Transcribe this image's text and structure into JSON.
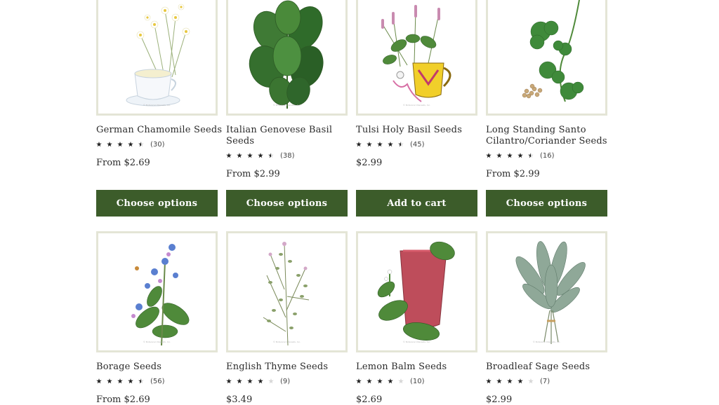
{
  "products": [
    {
      "name": "German Chamomile Seeds",
      "rating_value": 4.5,
      "review_count": "(30)",
      "price": "From $2.69",
      "button": "Choose options",
      "image_icon": "chamomile-illustration",
      "watermark": "© Botanical Interests, Inc."
    },
    {
      "name": "Italian Genovese Basil Seeds",
      "rating_value": 4.5,
      "review_count": "(38)",
      "price": "From $2.99",
      "button": "Choose options",
      "image_icon": "basil-illustration",
      "watermark": "© Botanical Interests, Inc."
    },
    {
      "name": "Tulsi Holy Basil Seeds",
      "rating_value": 4.5,
      "review_count": "(45)",
      "price": "$2.99",
      "button": "Add to cart",
      "image_icon": "holy-basil-mug-illustration",
      "watermark": "© Botanical Interests, Inc."
    },
    {
      "name": "Long Standing Santo Cilantro/Coriander Seeds",
      "rating_value": 4.5,
      "review_count": "(16)",
      "price": "From $2.99",
      "button": "Choose options",
      "image_icon": "cilantro-illustration",
      "watermark": ""
    },
    {
      "name": "Borage Seeds",
      "rating_value": 4.5,
      "review_count": "(56)",
      "price": "From $2.69",
      "image_icon": "borage-illustration",
      "watermark": "© Botanical Interests, Inc."
    },
    {
      "name": "English Thyme Seeds",
      "rating_value": 4,
      "review_count": "(9)",
      "price": "$3.49",
      "image_icon": "thyme-illustration",
      "watermark": "© Botanical Interests, Inc."
    },
    {
      "name": "Lemon Balm Seeds",
      "rating_value": 4,
      "review_count": "(10)",
      "price": "$2.69",
      "image_icon": "lemon-balm-glass-illustration",
      "watermark": "© Botanical Interests, Inc."
    },
    {
      "name": "Broadleaf Sage Seeds",
      "rating_value": 4,
      "review_count": "(7)",
      "price": "$2.99",
      "image_icon": "sage-bundle-illustration",
      "watermark": "© Botanical Interests, Inc."
    }
  ],
  "colors": {
    "button_bg": "#3c5c2a",
    "button_text": "#ffffff",
    "image_border": "#e4e5d6",
    "star_filled": "#1f1f1f",
    "star_empty": "#d6d6d6"
  }
}
